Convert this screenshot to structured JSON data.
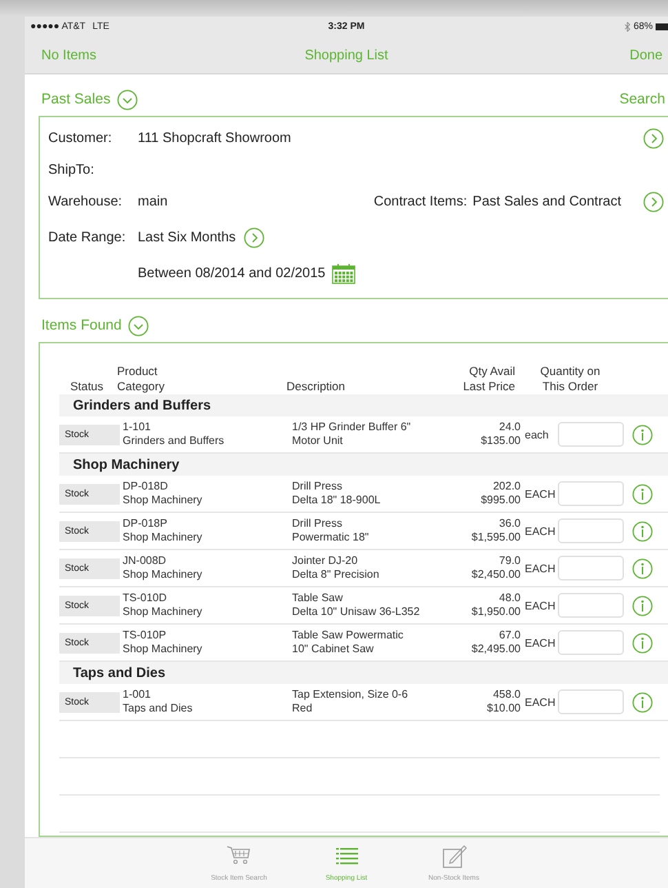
{
  "status_bar": {
    "carrier": "●●●●● AT&T",
    "network": "LTE",
    "time": "3:32 PM",
    "battery": "68%"
  },
  "nav_bar": {
    "left": "No Items",
    "title": "Shopping List",
    "right": "Done"
  },
  "past_sales": {
    "title": "Past Sales",
    "search": "Search",
    "fields": [
      {
        "kind": "customer",
        "label": "Customer:",
        "value": "111  Shopcraft Showroom"
      },
      {
        "kind": "shipto",
        "label": "ShipTo:"
      },
      {
        "kind": "warehouse",
        "label": "Warehouse:",
        "value": "main",
        "label_2": "Contract Items:",
        "value_2": "Past Sales and Contract"
      },
      {
        "kind": "date",
        "label": "Date Range:",
        "value": "Last Six Months",
        "between": "Between  08/2014 and 02/2015"
      }
    ]
  },
  "items_found": {
    "title": "Items Found",
    "columns": [
      {
        "kind": "status",
        "lines": [
          "Status"
        ]
      },
      {
        "kind": "product",
        "lines": [
          "Product",
          "Category"
        ]
      },
      {
        "kind": "description",
        "lines": [
          "Description"
        ]
      },
      {
        "kind": "qty",
        "lines": [
          "Qty Avail",
          "Last Price"
        ]
      },
      {
        "kind": "order",
        "lines": [
          "Quantity on",
          "This Order"
        ]
      }
    ],
    "groups": [
      {
        "name": "Grinders and Buffers",
        "items": [
          {
            "status": "Stock",
            "product": "1-101",
            "category": "Grinders and Buffers",
            "description": [
              "1/3 HP Grinder Buffer 6\"",
              "Motor Unit"
            ],
            "qty": "24.0",
            "price": "$135.00",
            "unit": "each"
          }
        ]
      },
      {
        "name": "Shop Machinery",
        "items": [
          {
            "status": "Stock",
            "product": "DP-018D",
            "category": "Shop Machinery",
            "description": [
              "Drill Press",
              "Delta 18\" 18-900L"
            ],
            "qty": "202.0",
            "price": "$995.00",
            "unit": "EACH"
          },
          {
            "status": "Stock",
            "product": "DP-018P",
            "category": "Shop Machinery",
            "description": [
              "Drill Press",
              "Powermatic 18\""
            ],
            "qty": "36.0",
            "price": "$1,595.00",
            "unit": "EACH"
          },
          {
            "status": "Stock",
            "product": "JN-008D",
            "category": "Shop Machinery",
            "description": [
              "Jointer DJ-20",
              "Delta 8\" Precision"
            ],
            "qty": "79.0",
            "price": "$2,450.00",
            "unit": "EACH"
          },
          {
            "status": "Stock",
            "product": "TS-010D",
            "category": "Shop Machinery",
            "description": [
              "Table Saw",
              "Delta 10\" Unisaw 36-L352"
            ],
            "qty": "48.0",
            "price": "$1,950.00",
            "unit": "EACH"
          },
          {
            "status": "Stock",
            "product": "TS-010P",
            "category": "Shop Machinery",
            "description": [
              "Table Saw Powermatic",
              "10\" Cabinet Saw"
            ],
            "qty": "67.0",
            "price": "$2,495.00",
            "unit": "EACH"
          }
        ]
      },
      {
        "name": "Taps and Dies",
        "items": [
          {
            "status": "Stock",
            "product": "1-001",
            "category": "Taps and Dies",
            "description": [
              "Tap Extension, Size 0-6",
              "Red"
            ],
            "qty": "458.0",
            "price": "$10.00",
            "unit": "EACH"
          }
        ]
      }
    ]
  },
  "tab_bar": {
    "items": [
      {
        "kind": "cart",
        "label": "Stock Item Search",
        "selected": false
      },
      {
        "kind": "list",
        "label": "Shopping List",
        "selected": true
      },
      {
        "kind": "edit",
        "label": "Non-Stock Items",
        "selected": false
      }
    ]
  }
}
